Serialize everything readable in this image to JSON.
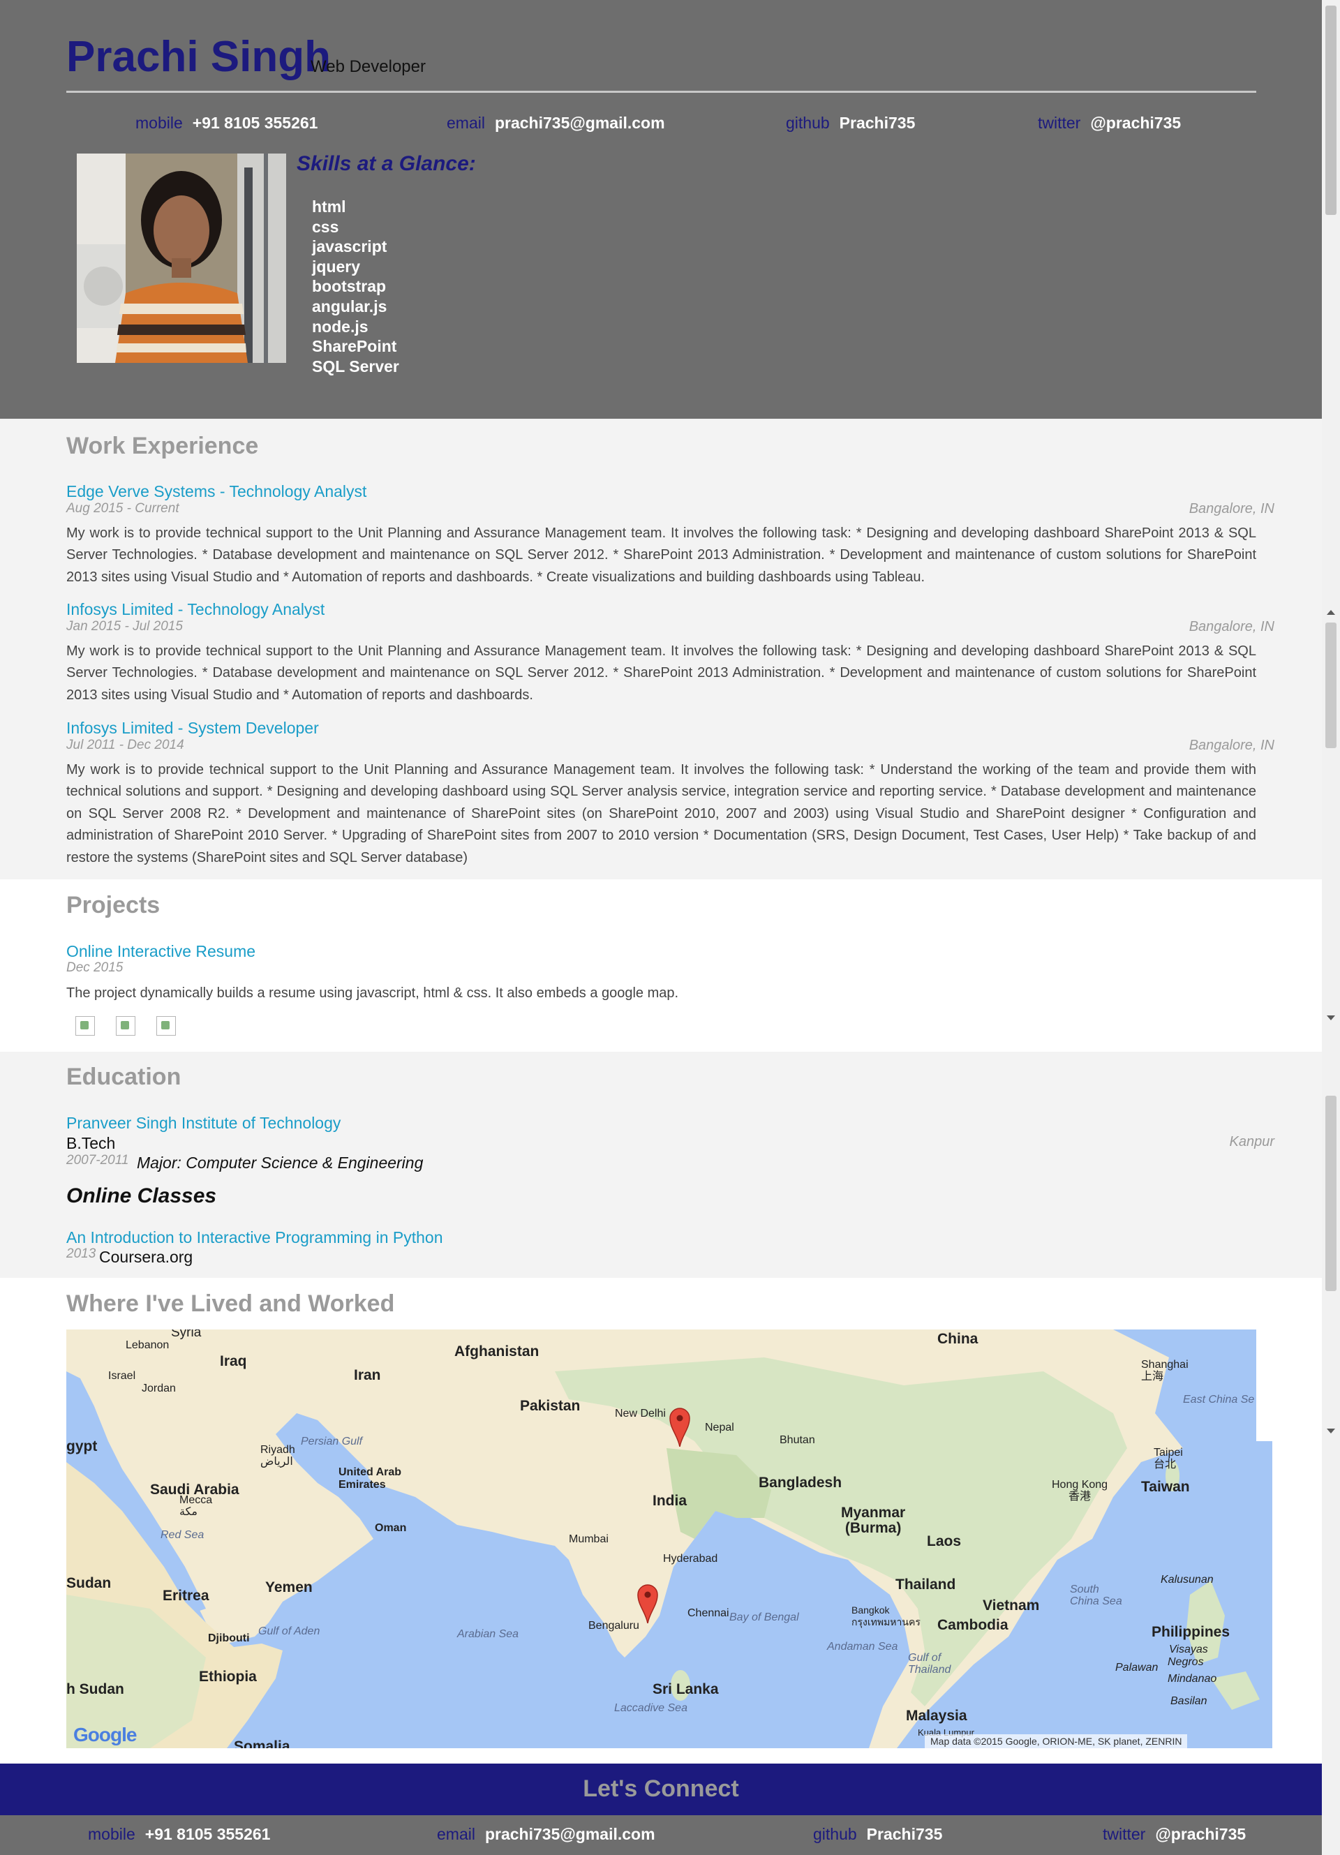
{
  "header": {
    "name": "Prachi Singh",
    "role": "Web Developer",
    "contacts": [
      {
        "label": "mobile",
        "value": "+91 8105 355261"
      },
      {
        "label": "email",
        "value": "prachi735@gmail.com"
      },
      {
        "label": "github",
        "value": "Prachi735"
      },
      {
        "label": "twitter",
        "value": "@prachi735"
      }
    ],
    "skills_title": "Skills at a Glance:",
    "skills": [
      "html",
      "css",
      "javascript",
      "jquery",
      "bootstrap",
      "angular.js",
      "node.js",
      "SharePoint",
      "SQL Server"
    ]
  },
  "work": {
    "title": "Work Experience",
    "jobs": [
      {
        "title": "Edge Verve Systems - Technology Analyst",
        "dates": "Aug 2015 - Current",
        "location": "Bangalore, IN",
        "description": "My work is to provide technical support to the Unit Planning and Assurance Management team. It involves the following task: * Designing and developing dashboard SharePoint 2013 & SQL Server Technologies. * Database development and maintenance on SQL Server 2012. * SharePoint 2013 Administration. * Development and maintenance of custom solutions for SharePoint 2013 sites using Visual Studio and * Automation of reports and dashboards. * Create visualizations and building dashboards using Tableau."
      },
      {
        "title": "Infosys Limited - Technology Analyst",
        "dates": "Jan 2015 - Jul 2015",
        "location": "Bangalore, IN",
        "description": "My work is to provide technical support to the Unit Planning and Assurance Management team. It involves the following task: * Designing and developing dashboard SharePoint 2013 & SQL Server Technologies. * Database development and maintenance on SQL Server 2012. * SharePoint 2013 Administration. * Development and maintenance of custom solutions for SharePoint 2013 sites using Visual Studio and * Automation of reports and dashboards."
      },
      {
        "title": "Infosys Limited - System Developer",
        "dates": "Jul 2011 - Dec 2014",
        "location": "Bangalore, IN",
        "description": "My work is to provide technical support to the Unit Planning and Assurance Management team. It involves the following task: * Understand the working of the team and provide them with technical solutions and support. * Designing and developing dashboard using SQL Server analysis service, integration service and reporting service. * Database development and maintenance on SQL Server 2008 R2. * Development and maintenance of SharePoint sites (on SharePoint 2010, 2007 and 2003) using Visual Studio and SharePoint designer * Configuration and administration of SharePoint 2010 Server. * Upgrading of SharePoint sites from 2007 to 2010 version * Documentation (SRS, Design Document, Test Cases, User Help) * Take backup of and restore the systems (SharePoint sites and SQL Server database)"
      }
    ]
  },
  "projects": {
    "title": "Projects",
    "items": [
      {
        "title": "Online Interactive Resume",
        "dates": "Dec 2015",
        "description": "The project dynamically builds a resume using javascript, html & css. It also embeds a google map."
      }
    ]
  },
  "education": {
    "title": "Education",
    "schools": [
      {
        "name": "Pranveer Singh Institute of Technology",
        "degree": "B.Tech",
        "dates": "2007-2011",
        "major": "Major: Computer Science & Engineering",
        "location": "Kanpur"
      }
    ],
    "online_title": "Online Classes",
    "online": [
      {
        "title": "An Introduction to Interactive Programming in Python",
        "dates": "2013",
        "school": "Coursera.org"
      }
    ]
  },
  "map": {
    "title": "Where I've Lived and Worked",
    "labels": {
      "syria": "Syria",
      "lebanon": "Lebanon",
      "israel": "Israel",
      "jordan": "Jordan",
      "iraq": "Iraq",
      "iran": "Iran",
      "afghanistan": "Afghanistan",
      "pakistan": "Pakistan",
      "china": "China",
      "nepal": "Nepal",
      "bhutan": "Bhutan",
      "bangladesh": "Bangladesh",
      "india": "India",
      "myanmar": "Myanmar\n(Burma)",
      "laos": "Laos",
      "thailand": "Thailand",
      "vietnam": "Vietnam",
      "cambodia": "Cambodia",
      "philippines": "Philippines",
      "taiwan": "Taiwan",
      "malaysia": "Malaysia",
      "sri_lanka": "Sri Lanka",
      "saudi": "Saudi Arabia",
      "uae": "United Arab\nEmirates",
      "oman": "Oman",
      "yemen": "Yemen",
      "eritrea": "Eritrea",
      "ethiopia": "Ethiopia",
      "djibouti": "Djibouti",
      "sudan": "Sudan",
      "s_sudan": "h Sudan",
      "egypt": "gypt",
      "somalia": "Somalia",
      "persian_gulf": "Persian Gulf",
      "red_sea": "Red Sea",
      "arabian_sea": "Arabian Sea",
      "bay_bengal": "Bay of Bengal",
      "andaman": "Andaman Sea",
      "gulf_aden": "Gulf of Aden",
      "gulf_thailand": "Gulf of\nThailand",
      "south_china": "South\nChina Sea",
      "east_china": "East China Se",
      "laccadive": "Laccadive Sea",
      "new_delhi": "New Delhi",
      "mumbai": "Mumbai",
      "hyderabad": "Hyderabad",
      "chennai": "Chennai",
      "bengaluru": "Bengaluru",
      "bangkok": "Bangkok\nกรุงเทพมหานคร",
      "hong_kong": "Hong Kong\n香港",
      "taipei": "Taipei\n台北",
      "shanghai": "Shanghai\n上海",
      "riyadh": "Riyadh\nالرياض",
      "mecca": "Mecca\nمكة",
      "kalusunan": "Kalusunan",
      "visayas": "Visayas",
      "negros": "Negros",
      "mindanao": "Mindanao",
      "palawan": "Palawan",
      "basilan": "Basilan",
      "kuala": "Kuala Lumpur"
    },
    "attribution": "Map data ©2015 Google, ORION-ME, SK planet, ZENRIN",
    "logo": "Google"
  },
  "footer": {
    "title": "Let's Connect",
    "contacts": [
      {
        "label": "mobile",
        "value": "+91 8105 355261"
      },
      {
        "label": "email",
        "value": "prachi735@gmail.com"
      },
      {
        "label": "github",
        "value": "Prachi735"
      },
      {
        "label": "twitter",
        "value": "@prachi735"
      }
    ]
  },
  "colors": {
    "header_bg": "#6e6e6e",
    "name": "#1c1a7e",
    "link": "#1a9dc8",
    "section_title": "#9a9a9a",
    "footer_bar": "#1c1a7e"
  }
}
